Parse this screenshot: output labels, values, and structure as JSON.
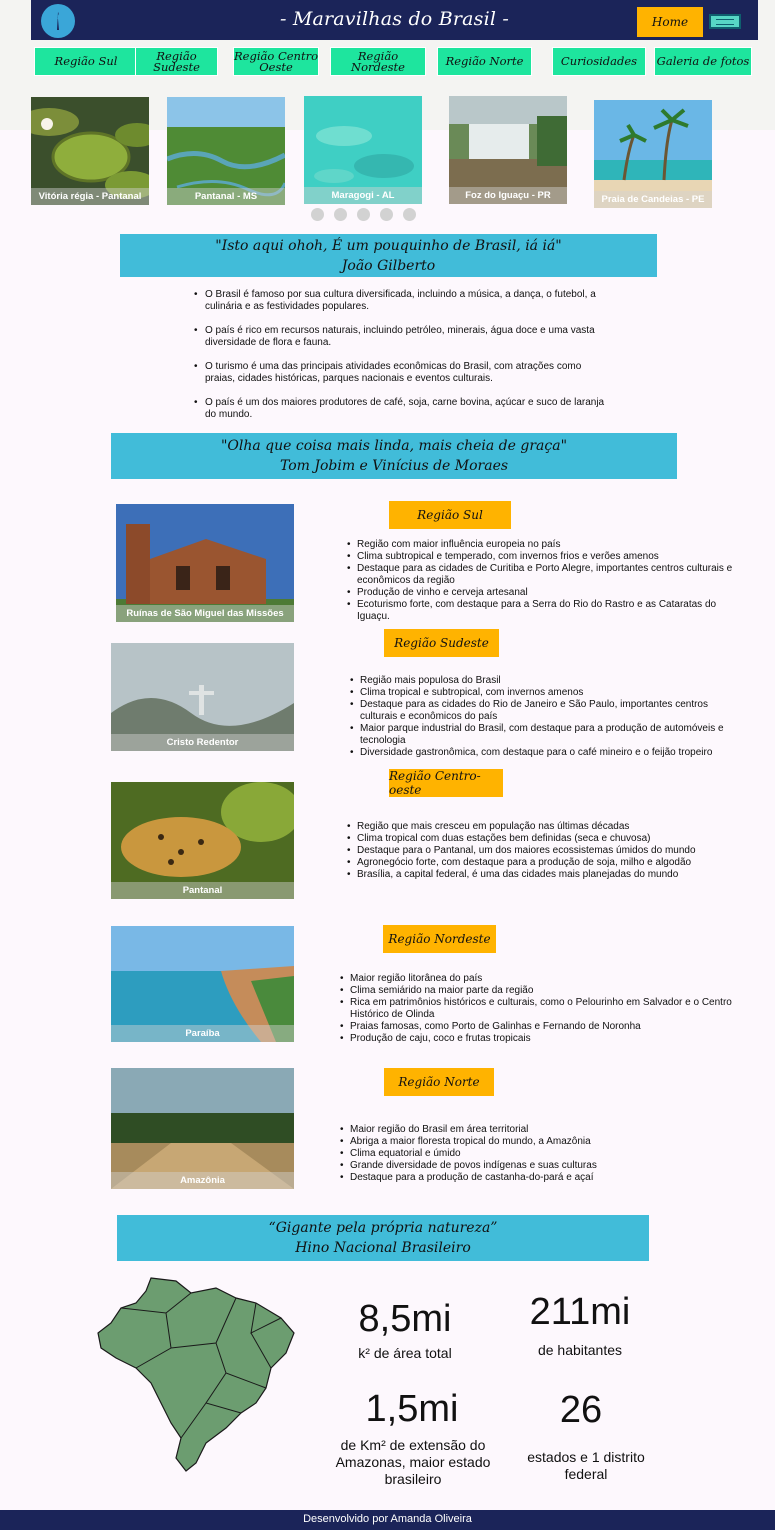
{
  "header": {
    "title": "- Maravilhas do Brasil -",
    "home_label": "Home",
    "logo_icon": "tocha-icon",
    "menu_icon": "hamburger-menu-icon"
  },
  "nav": [
    {
      "label": "Região Sul"
    },
    {
      "label": "Região Sudeste"
    },
    {
      "label": "Região Centro Oeste"
    },
    {
      "label": "Região Nordeste"
    },
    {
      "label": "Região Norte"
    },
    {
      "label": "Curiosidades"
    },
    {
      "label": "Galeria de fotos"
    }
  ],
  "carousel": [
    {
      "caption": "Vitória régia - Pantanal"
    },
    {
      "caption": "Pantanal - MS"
    },
    {
      "caption": "Maragogi - AL"
    },
    {
      "caption": "Foz do Iguaçu - PR"
    },
    {
      "caption": "Praia de Candeias - PE"
    }
  ],
  "quotes": [
    {
      "text": "\"Isto aqui ohoh, É um pouquinho de Brasil, iá iá\"",
      "author": "João Gilberto"
    },
    {
      "text": "\"Olha que coisa mais linda, mais cheia de graça\"",
      "author": "Tom Jobim e Vinícius de Moraes"
    },
    {
      "text": "“Gigante pela própria natureza”",
      "author": "Hino Nacional Brasileiro"
    }
  ],
  "facts": [
    "O Brasil é famoso por sua cultura diversificada, incluindo a música, a dança, o futebol, a culinária e as festividades populares.",
    "O país é rico em recursos naturais, incluindo petróleo, minerais, água doce e uma vasta diversidade de flora e fauna.",
    "O turismo é uma das principais atividades econômicas do Brasil, com atrações como praias, cidades históricas, parques nacionais e eventos culturais.",
    "O país é um dos maiores produtores de café, soja, carne bovina, açúcar e suco de laranja do mundo."
  ],
  "regions": [
    {
      "title": "Região Sul",
      "caption": "Ruínas de  São Miguel das Missões",
      "items": [
        "Região com maior influência europeia no país",
        "Clima subtropical e temperado, com invernos frios e verões amenos",
        "Destaque para as cidades de Curitiba e Porto Alegre, importantes centros culturais e econômicos da região",
        "Produção de vinho e cerveja artesanal",
        "Ecoturismo forte, com destaque para a Serra do Rio do Rastro e as Cataratas do Iguaçu."
      ]
    },
    {
      "title": "Região Sudeste",
      "caption": "Cristo Redentor",
      "items": [
        "Região mais populosa do Brasil",
        "Clima tropical e subtropical, com invernos amenos",
        "Destaque para as cidades do Rio de Janeiro e São Paulo, importantes centros culturais e econômicos do país",
        "Maior parque industrial do Brasil, com destaque para a produção de automóveis e tecnologia",
        "Diversidade gastronômica, com destaque para o café mineiro e o feijão tropeiro"
      ]
    },
    {
      "title": "Região Centro-oeste",
      "caption": "Pantanal",
      "items": [
        "Região que mais cresceu em população nas últimas décadas",
        "Clima tropical com duas estações bem definidas (seca e chuvosa)",
        "Destaque para o Pantanal, um dos maiores ecossistemas úmidos do mundo",
        "Agronegócio forte, com destaque para a produção de soja, milho e algodão",
        "Brasília, a capital federal, é uma das cidades mais planejadas do mundo"
      ]
    },
    {
      "title": "Região Nordeste",
      "caption": "Paraíba",
      "items": [
        "Maior região litorânea do país",
        "Clima semiárido na maior parte da região",
        "Rica em patrimônios históricos e culturais, como o Pelourinho em Salvador e o Centro Histórico de Olinda",
        "Praias famosas, como Porto de Galinhas e Fernando de Noronha",
        "Produção de caju, coco e frutas tropicais"
      ]
    },
    {
      "title": "Região Norte",
      "caption": "Amazônia",
      "items": [
        "Maior região do Brasil em área territorial",
        "Abriga a maior floresta tropical do mundo, a Amazônia",
        "Clima equatorial e úmido",
        "Grande diversidade de povos indígenas e suas culturas",
        "Destaque para a produção de castanha-do-pará e açaí"
      ]
    }
  ],
  "stats": [
    {
      "value": "8,5mi",
      "label": "k² de área total"
    },
    {
      "value": "211mi",
      "label": "de habitantes"
    },
    {
      "value": "1,5mi",
      "label": "de Km² de extensão do Amazonas, maior estado brasileiro"
    },
    {
      "value": "26",
      "label": "estados e 1 distrito federal"
    }
  ],
  "footer": {
    "text": "Desenvolvido por Amanda Oliveira"
  },
  "colors": {
    "navy": "#1b2459",
    "orange": "#ffb300",
    "green": "#1ee59e",
    "cyan": "#41bcd9",
    "map": "#6c9d70"
  }
}
